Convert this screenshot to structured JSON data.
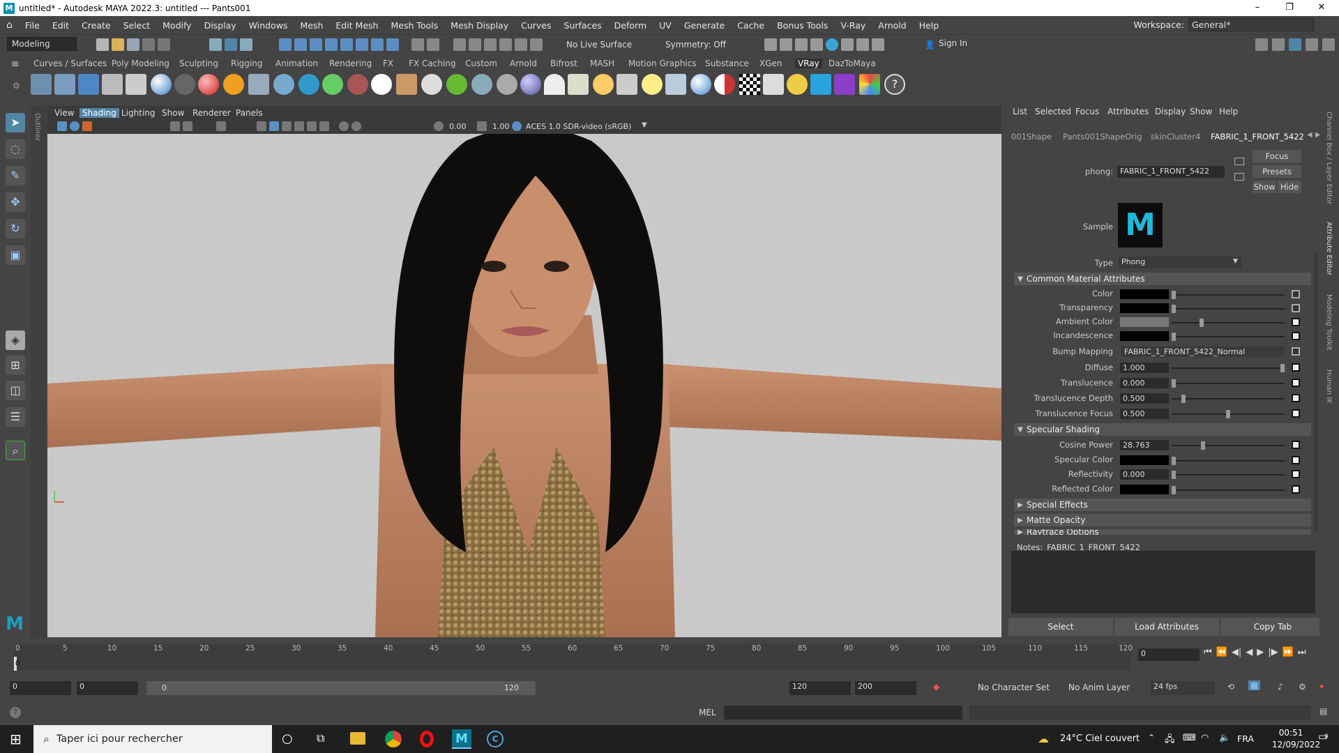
{
  "window": {
    "title": "untitled* - Autodesk MAYA 2022.3: untitled  ---  Pants001",
    "logo": "M",
    "minimize": "–",
    "maximize": "❐",
    "close": "✕"
  },
  "menubar": {
    "items": [
      "File",
      "Edit",
      "Create",
      "Select",
      "Modify",
      "Display",
      "Windows",
      "Mesh",
      "Edit Mesh",
      "Mesh Tools",
      "Mesh Display",
      "Curves",
      "Surfaces",
      "Deform",
      "UV",
      "Generate",
      "Cache",
      "Bonus Tools",
      "V-Ray",
      "Arnold",
      "Help"
    ],
    "workspace_label": "Workspace:",
    "workspace_value": "General*"
  },
  "statusline": {
    "mode": "Modeling",
    "live_surface": "No Live Surface",
    "symmetry": "Symmetry: Off",
    "sign_in": "Sign In"
  },
  "shelf_tabs": [
    "Curves / Surfaces",
    "Poly Modeling",
    "Sculpting",
    "Rigging",
    "Animation",
    "Rendering",
    "FX",
    "FX Caching",
    "Custom",
    "Arnold",
    "Bifrost",
    "MASH",
    "Motion Graphics",
    "Substance",
    "XGen",
    "VRay",
    "DazToMaya"
  ],
  "shelf_active": "VRay",
  "outliner_label": "Outliner",
  "viewport": {
    "menu": [
      "View",
      "Shading",
      "Lighting",
      "Show",
      "Renderer",
      "Panels"
    ],
    "active_menu": "Shading",
    "exposure": "0.00",
    "gamma": "1.00",
    "colorspace": "ACES 1.0 SDR-video (sRGB)"
  },
  "attribute_editor": {
    "menu": [
      "List",
      "Selected",
      "Focus",
      "Attributes",
      "Display",
      "Show",
      "Help"
    ],
    "tabs": [
      "001Shape",
      "Pants001ShapeOrig",
      "skinCluster4",
      "FABRIC_1_FRONT_5422"
    ],
    "active_tab": "FABRIC_1_FRONT_5422",
    "node_type_label": "phong:",
    "node_name": "FABRIC_1_FRONT_5422",
    "focus": "Focus",
    "presets": "Presets",
    "show": "Show",
    "hide": "Hide",
    "sample_label": "Sample",
    "sample_glyph": "M",
    "type_label": "Type",
    "type_value": "Phong",
    "sections": {
      "common": "Common Material Attributes",
      "specular": "Specular Shading",
      "special": "Special Effects",
      "matte": "Matte Opacity",
      "raytrace": "Raytrace Options"
    },
    "common_attrs": [
      {
        "label": "Color",
        "value": ""
      },
      {
        "label": "Transparency",
        "value": ""
      },
      {
        "label": "Ambient Color",
        "value": ""
      },
      {
        "label": "Incandescence",
        "value": ""
      },
      {
        "label": "Bump Mapping",
        "value": "FABRIC_1_FRONT_5422_Normal"
      },
      {
        "label": "Diffuse",
        "value": "1.000"
      },
      {
        "label": "Translucence",
        "value": "0.000"
      },
      {
        "label": "Translucence Depth",
        "value": "0.500"
      },
      {
        "label": "Translucence Focus",
        "value": "0.500"
      }
    ],
    "specular_attrs": [
      {
        "label": "Cosine Power",
        "value": "28.763"
      },
      {
        "label": "Specular Color",
        "value": ""
      },
      {
        "label": "Reflectivity",
        "value": "0.000"
      },
      {
        "label": "Reflected Color",
        "value": ""
      }
    ],
    "notes_label": "Notes:",
    "notes_value": "FABRIC_1_FRONT_5422",
    "buttons": [
      "Select",
      "Load Attributes",
      "Copy Tab"
    ]
  },
  "side_tabs": [
    "Channel Box / Layer Editor",
    "Attribute Editor",
    "Modeling Toolkit",
    "Human IK"
  ],
  "timeline": {
    "ticks": [
      "5",
      "10",
      "15",
      "20",
      "25",
      "30",
      "35",
      "40",
      "45",
      "50",
      "55",
      "60",
      "65",
      "70",
      "75",
      "80",
      "85",
      "90",
      "95",
      "100",
      "105",
      "110",
      "115",
      "120"
    ],
    "start_mark": "0",
    "current_frame": "0"
  },
  "range": {
    "start": "0",
    "anim_start": "0",
    "slider_start": "0",
    "slider_end": "120",
    "end": "120",
    "anim_end": "200",
    "character_set": "No Character Set",
    "anim_layer": "No Anim Layer",
    "fps": "24 fps"
  },
  "cmdline": {
    "lang": "MEL",
    "help": "?"
  },
  "taskbar": {
    "search_placeholder": "Taper ici pour rechercher",
    "weather": "24°C  Ciel couvert",
    "lang": "FRA",
    "time": "00:51",
    "date": "12/09/2022",
    "notif_count": "9"
  }
}
